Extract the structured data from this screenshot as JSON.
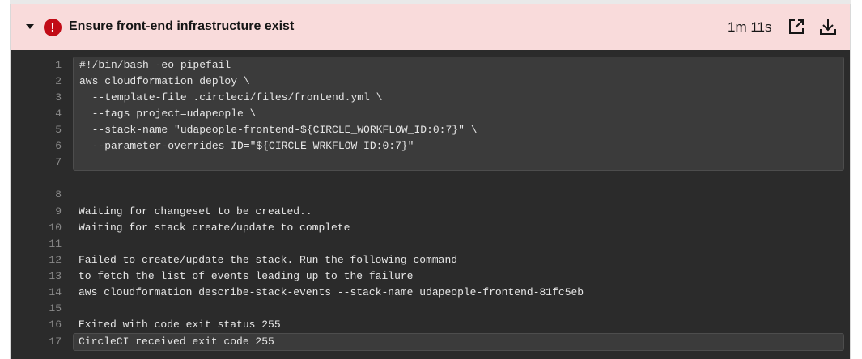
{
  "step": {
    "title": "Ensure front-end infrastructure exist",
    "duration": "1m 11s",
    "status_icon": "!",
    "status_color": "#c20c17",
    "header_bg": "#f9dbdb"
  },
  "command_lines": [
    {
      "num": "1",
      "text": "#!/bin/bash -eo pipefail"
    },
    {
      "num": "2",
      "text": "aws cloudformation deploy \\"
    },
    {
      "num": "3",
      "text": "  --template-file .circleci/files/frontend.yml \\"
    },
    {
      "num": "4",
      "text": "  --tags project=udapeople \\"
    },
    {
      "num": "5",
      "text": "  --stack-name \"udapeople-frontend-${CIRCLE_WORKFLOW_ID:0:7}\" \\"
    },
    {
      "num": "6",
      "text": "  --parameter-overrides ID=\"${CIRCLE_WRKFLOW_ID:0:7}\""
    },
    {
      "num": "7",
      "text": ""
    }
  ],
  "output_lines": [
    {
      "num": "8",
      "text": ""
    },
    {
      "num": "9",
      "text": "Waiting for changeset to be created.."
    },
    {
      "num": "10",
      "text": "Waiting for stack create/update to complete"
    },
    {
      "num": "11",
      "text": ""
    },
    {
      "num": "12",
      "text": "Failed to create/update the stack. Run the following command"
    },
    {
      "num": "13",
      "text": "to fetch the list of events leading up to the failure"
    },
    {
      "num": "14",
      "text": "aws cloudformation describe-stack-events --stack-name udapeople-frontend-81fc5eb"
    },
    {
      "num": "15",
      "text": ""
    },
    {
      "num": "16",
      "text": "Exited with code exit status 255"
    },
    {
      "num": "17",
      "text": "CircleCI received exit code 255"
    }
  ]
}
